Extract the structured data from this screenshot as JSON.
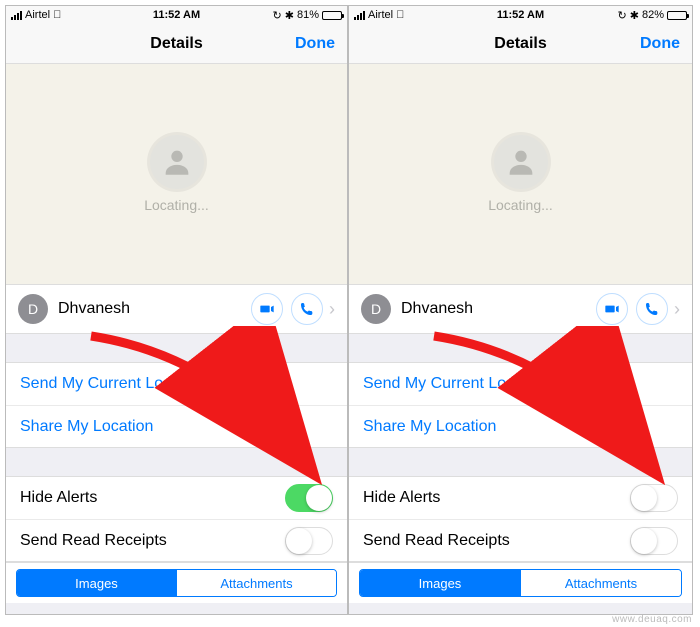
{
  "watermark": "www.deuaq.com",
  "screens": [
    {
      "status": {
        "carrier": "Airtel",
        "time": "11:52 AM",
        "battery_pct": "81%",
        "battery_fill": 81
      },
      "nav": {
        "title": "Details",
        "done": "Done"
      },
      "map": {
        "locating": "Locating..."
      },
      "contact": {
        "initial": "D",
        "name": "Dhvanesh"
      },
      "links": {
        "send": "Send My Current Location",
        "share": "Share My Location"
      },
      "toggles": {
        "hide_alerts_label": "Hide Alerts",
        "hide_alerts_on": true,
        "read_receipts_label": "Send Read Receipts",
        "read_receipts_on": false
      },
      "segmented": {
        "images": "Images",
        "attachments": "Attachments"
      }
    },
    {
      "status": {
        "carrier": "Airtel",
        "time": "11:52 AM",
        "battery_pct": "82%",
        "battery_fill": 82
      },
      "nav": {
        "title": "Details",
        "done": "Done"
      },
      "map": {
        "locating": "Locating..."
      },
      "contact": {
        "initial": "D",
        "name": "Dhvanesh"
      },
      "links": {
        "send": "Send My Current Location",
        "share": "Share My Location"
      },
      "toggles": {
        "hide_alerts_label": "Hide Alerts",
        "hide_alerts_on": false,
        "read_receipts_label": "Send Read Receipts",
        "read_receipts_on": false
      },
      "segmented": {
        "images": "Images",
        "attachments": "Attachments"
      }
    }
  ]
}
